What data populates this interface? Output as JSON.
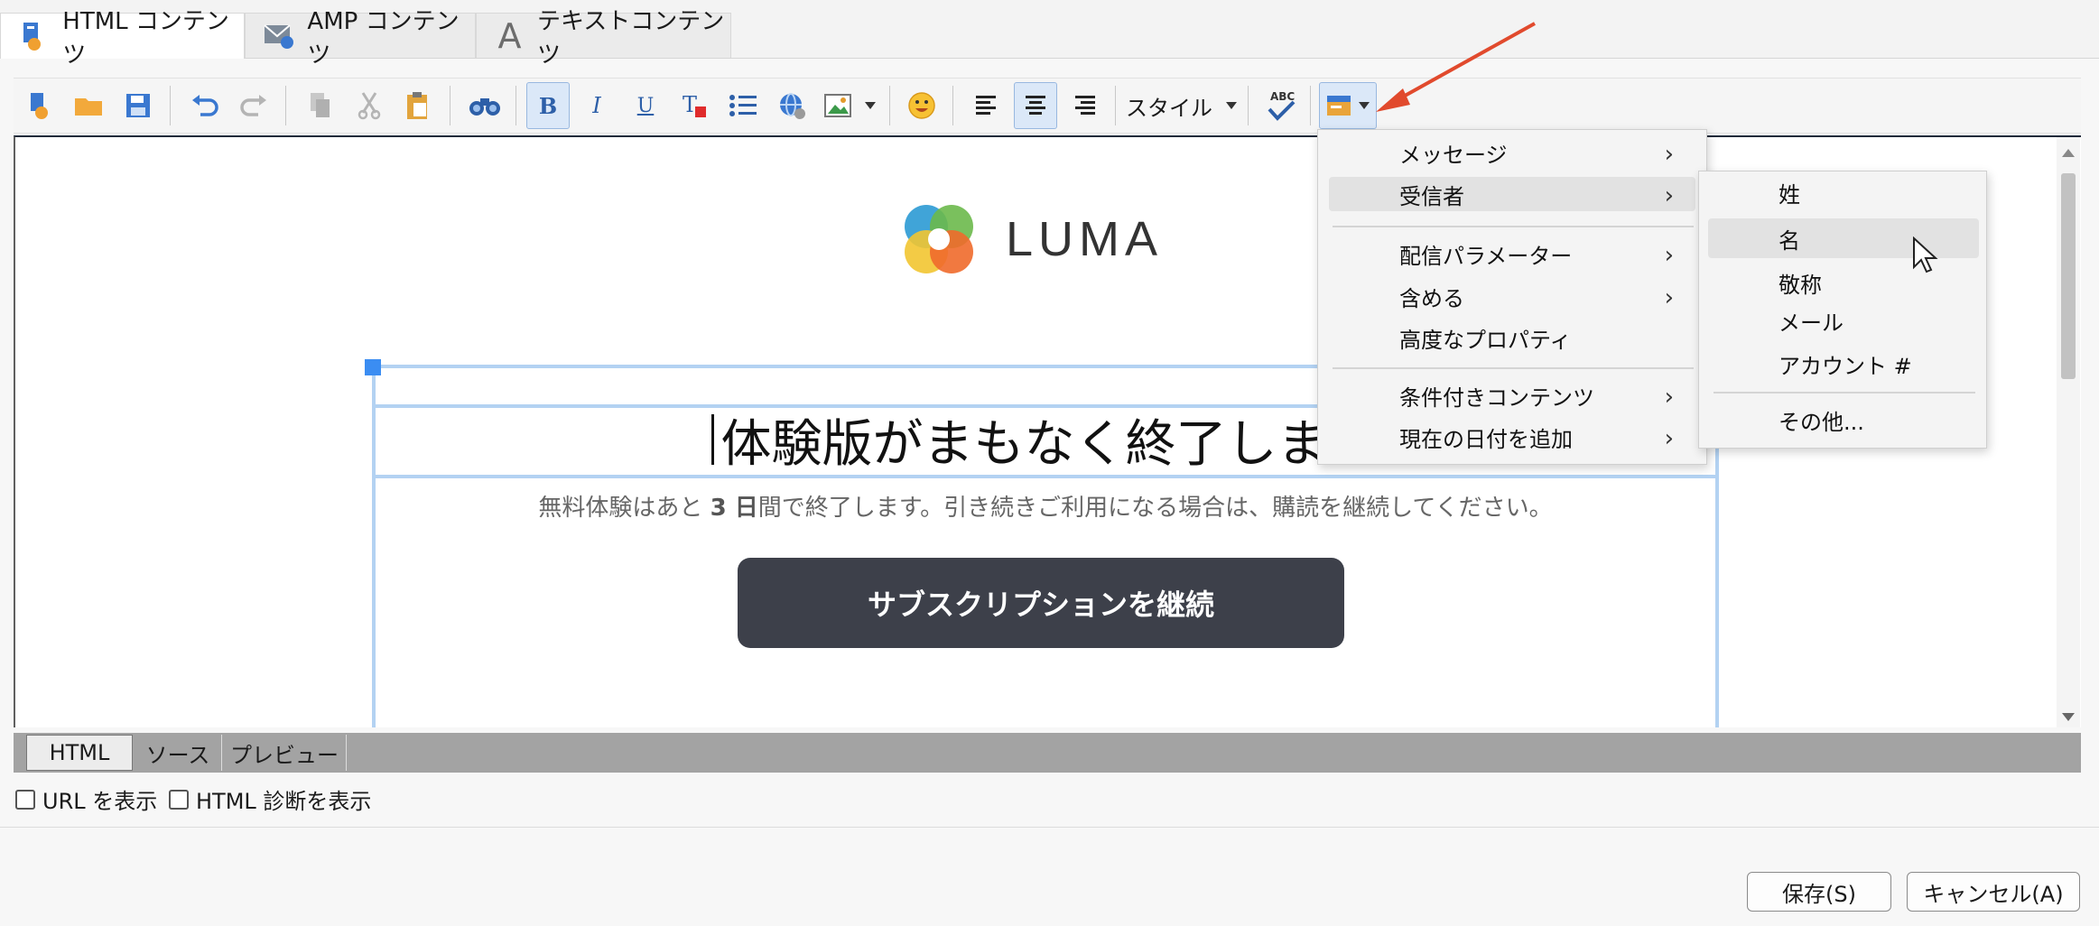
{
  "tabs": [
    {
      "label": "HTML コンテンツ",
      "icon": "html-content-icon",
      "active": true
    },
    {
      "label": "AMP コンテンツ",
      "icon": "amp-mail-icon",
      "active": false
    },
    {
      "label": "テキストコンテンツ",
      "icon": "text-a-icon",
      "active": false
    }
  ],
  "toolbar": {
    "style_label": "スタイル",
    "icons": [
      "new-doc-icon",
      "open-folder-icon",
      "save-icon",
      "undo-icon",
      "redo-icon",
      "copy-icon",
      "cut-icon",
      "paste-icon",
      "find-binoculars-icon",
      "bold-icon",
      "italic-icon",
      "underline-icon",
      "clear-format-icon",
      "bullet-list-icon",
      "link-globe-icon",
      "image-icon",
      "emoji-icon",
      "align-left-icon",
      "align-center-icon",
      "align-right-icon",
      "spellcheck-icon",
      "personalization-icon"
    ],
    "bold": "B",
    "italic": "I",
    "underline": "U",
    "clear": "T",
    "spell": "ABC"
  },
  "email": {
    "logo_text": "LUMA",
    "headline": "体験版がまもなく終了します",
    "body_prefix": "無料体験はあと ",
    "body_bold": "3 日",
    "body_suffix": "間で終了します。引き続きご利用になる場合は、購読を継続してください。",
    "cta_label": "サブスクリプションを継続"
  },
  "menu": {
    "items": [
      {
        "label": "メッセージ",
        "submenu": true
      },
      {
        "label": "受信者",
        "submenu": true,
        "highlighted": true
      },
      {
        "label": "配信パラメーター",
        "submenu": true
      },
      {
        "label": "含める",
        "submenu": true
      },
      {
        "label": "高度なプロパティ",
        "submenu": false
      },
      {
        "label": "条件付きコンテンツ",
        "submenu": true
      },
      {
        "label": "現在の日付を追加",
        "submenu": true
      }
    ]
  },
  "submenu": {
    "items": [
      {
        "label": "姓"
      },
      {
        "label": "名",
        "highlighted": true
      },
      {
        "label": "敬称"
      },
      {
        "label": "メール"
      },
      {
        "label": "アカウント #"
      },
      {
        "label": "その他..."
      }
    ]
  },
  "bottom_tabs": [
    {
      "label": "HTML",
      "active": true
    },
    {
      "label": "ソース",
      "active": false
    },
    {
      "label": "プレビュー",
      "active": false
    }
  ],
  "options": {
    "show_url": "URL を表示",
    "show_diag": "HTML 診断を表示"
  },
  "buttons": {
    "save": "保存(S)",
    "cancel": "キャンセル(A)"
  },
  "colors": {
    "accent_arrow": "#e14a2d",
    "cta_bg": "#3d404a",
    "selection_blue": "#b3d2f2",
    "handle_blue": "#3b8df2"
  }
}
